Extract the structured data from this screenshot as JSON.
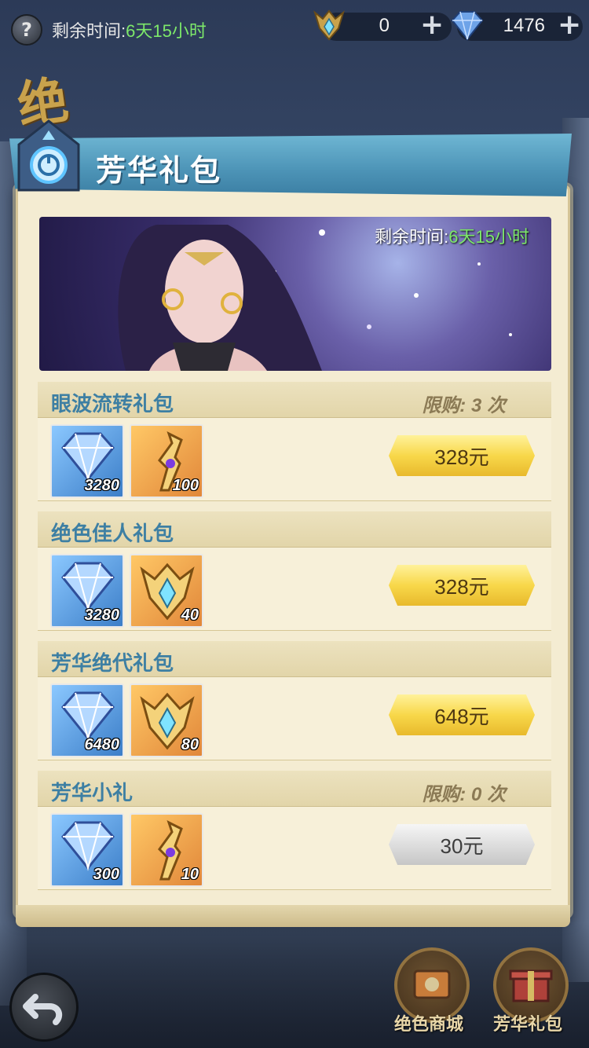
{
  "top_bar": {
    "help_label": "?",
    "timer_label": "剩余时间:",
    "timer_value": "6天15小时",
    "currencies": [
      {
        "icon": "crown-gem-icon",
        "value": "0",
        "plus": "+"
      },
      {
        "icon": "diamond-icon",
        "value": "1476",
        "plus": "+"
      }
    ]
  },
  "side_char": "绝",
  "header": {
    "title": "芳华礼包"
  },
  "banner": {
    "timer_label": "剩余时间:",
    "timer_value": "6天15小时"
  },
  "packs": [
    {
      "name": "眼波流转礼包",
      "limit": "限购: 3 次",
      "items": [
        {
          "icon": "diamond-icon",
          "qty": "3280"
        },
        {
          "icon": "staff-icon",
          "qty": "100"
        }
      ],
      "price": "328元",
      "enabled": true
    },
    {
      "name": "绝色佳人礼包",
      "limit": "",
      "items": [
        {
          "icon": "diamond-icon",
          "qty": "3280"
        },
        {
          "icon": "crown-gem-icon",
          "qty": "40"
        }
      ],
      "price": "328元",
      "enabled": true
    },
    {
      "name": "芳华绝代礼包",
      "limit": "",
      "items": [
        {
          "icon": "diamond-icon",
          "qty": "6480"
        },
        {
          "icon": "crown-gem-icon",
          "qty": "80"
        }
      ],
      "price": "648元",
      "enabled": true
    },
    {
      "name": "芳华小礼",
      "limit": "限购: 0 次",
      "items": [
        {
          "icon": "diamond-icon",
          "qty": "300"
        },
        {
          "icon": "staff-icon",
          "qty": "10"
        }
      ],
      "price": "30元",
      "enabled": false
    }
  ],
  "bottom_nav": {
    "mall_label": "绝色商城",
    "gift_label": "芳华礼包"
  },
  "colors": {
    "accent_blue": "#3d7fa3",
    "timer_green": "#7de86a",
    "button_gold": "#f8d84a",
    "button_disabled": "#dedede"
  }
}
